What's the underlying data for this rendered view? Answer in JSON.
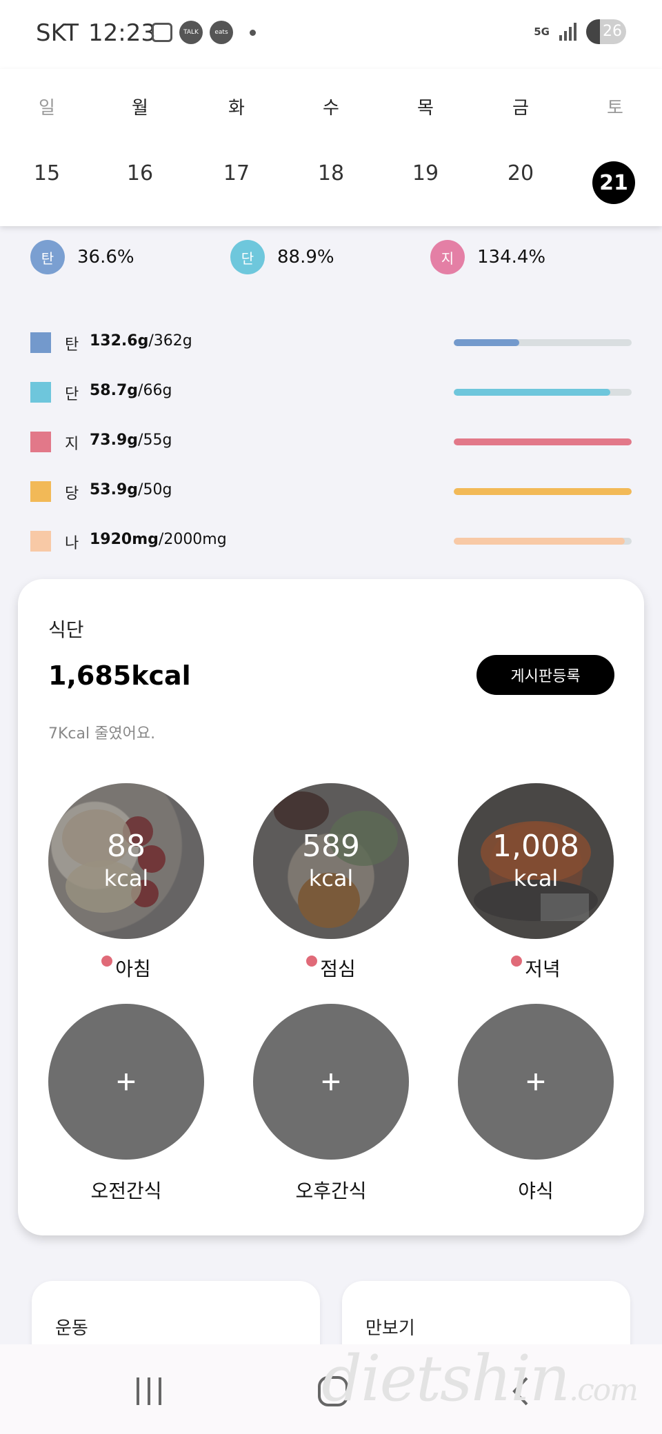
{
  "status_bar": {
    "carrier": "SKT",
    "time": "12:23",
    "network": "5G",
    "battery": "26",
    "icons": [
      "screenshot-icon",
      "kakaotalk-icon",
      "coupang-eats-icon"
    ],
    "talk_label": "TALK",
    "eats_label": "eats"
  },
  "calendar": {
    "days": [
      "일",
      "월",
      "화",
      "수",
      "목",
      "금",
      "토"
    ],
    "dates": [
      "15",
      "16",
      "17",
      "18",
      "19",
      "20",
      "21"
    ],
    "selected_index": 6
  },
  "ratios": [
    {
      "badge": "탄",
      "value": "36.6%",
      "color": "#7a9fd1"
    },
    {
      "badge": "단",
      "value": "88.9%",
      "color": "#6ec7dc"
    },
    {
      "badge": "지",
      "value": "134.4%",
      "color": "#e47fa5"
    }
  ],
  "nutrients": [
    {
      "label": "탄",
      "amount": "132.6g",
      "goal": "/362g",
      "color": "#7399cc",
      "progress": 0.37
    },
    {
      "label": "단",
      "amount": "58.7g",
      "goal": "/66g",
      "color": "#6ec6dc",
      "progress": 0.88
    },
    {
      "label": "지",
      "amount": "73.9g",
      "goal": "/55g",
      "color": "#e27889",
      "progress": 1.0
    },
    {
      "label": "당",
      "amount": "53.9g",
      "goal": "/50g",
      "color": "#f2b957",
      "progress": 1.0
    },
    {
      "label": "나",
      "amount": "1920mg",
      "goal": "/2000mg",
      "color": "#f8c9a6",
      "progress": 0.96
    }
  ],
  "diet": {
    "title": "식단",
    "total_kcal": "1,685kcal",
    "register_button": "게시판등록",
    "subtitle": "7Kcal 줄였어요.",
    "meals": [
      {
        "name": "아침",
        "kcal": "88",
        "unit": "kcal"
      },
      {
        "name": "점심",
        "kcal": "589",
        "unit": "kcal"
      },
      {
        "name": "저녁",
        "kcal": "1,008",
        "unit": "kcal"
      }
    ],
    "snacks": [
      {
        "name": "오전간식",
        "symbol": "+"
      },
      {
        "name": "오후간식",
        "symbol": "+"
      },
      {
        "name": "야식",
        "symbol": "+"
      }
    ]
  },
  "bottom_cards": {
    "exercise": "운동",
    "steps": "만보기"
  },
  "watermark": {
    "main": "dietshin",
    "suffix": ".com"
  }
}
